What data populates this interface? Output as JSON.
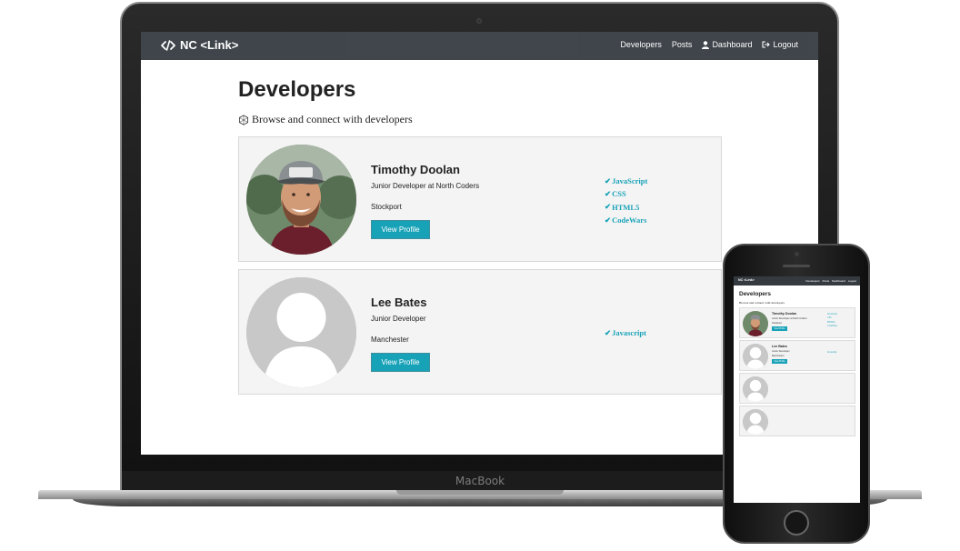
{
  "device_labels": {
    "laptop": "MacBook"
  },
  "nav": {
    "brand": "NC <Link>",
    "links": [
      {
        "label": "Developers",
        "icon": ""
      },
      {
        "label": "Posts",
        "icon": ""
      },
      {
        "label": "Dashboard",
        "icon": "user-icon"
      },
      {
        "label": "Logout",
        "icon": "sign-out-icon"
      }
    ]
  },
  "page": {
    "title": "Developers",
    "lead": "Browse and connect with developers",
    "lead_icon": "connectdevelop-icon"
  },
  "profiles": [
    {
      "name": "Timothy Doolan",
      "status": "Junior Developer at North Coders",
      "location": "Stockport",
      "button": "View Profile",
      "avatar": "photo",
      "skills": [
        "JavaScript",
        "CSS",
        "HTML5",
        "CodeWars"
      ]
    },
    {
      "name": "Lee Bates",
      "status": "Junior Developer",
      "location": "Manchester",
      "button": "View Profile",
      "avatar": "placeholder",
      "skills": [
        "Javascript"
      ]
    }
  ],
  "colors": {
    "navbar": "#343a40",
    "accent": "#17a2b8",
    "card_bg": "#f4f4f4"
  }
}
